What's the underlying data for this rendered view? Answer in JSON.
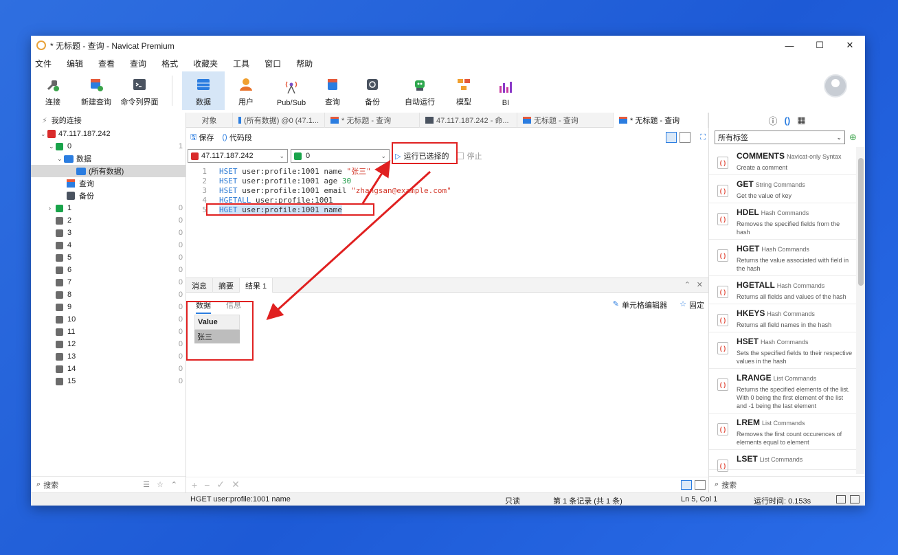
{
  "window": {
    "title": "* 无标题 - 查询 - Navicat Premium"
  },
  "menu": [
    "文件",
    "编辑",
    "查看",
    "查询",
    "格式",
    "收藏夹",
    "工具",
    "窗口",
    "帮助"
  ],
  "toolbar": {
    "connect": "连接",
    "new_query": "新建查询",
    "cmd": "命令列界面",
    "data": "数据",
    "user": "用户",
    "pubsub": "Pub/Sub",
    "query": "查询",
    "backup": "备份",
    "auto_run": "自动运行",
    "model": "模型",
    "bi": "BI"
  },
  "left": {
    "header": "我的连接",
    "connection": "47.117.187.242",
    "db0": "0",
    "db0_count": "1",
    "data_node": "数据",
    "all_data": "(所有数据)",
    "query_node": "查询",
    "backup_node": "备份",
    "dbs": [
      {
        "name": "1",
        "count": "0"
      },
      {
        "name": "2",
        "count": "0"
      },
      {
        "name": "3",
        "count": "0"
      },
      {
        "name": "4",
        "count": "0"
      },
      {
        "name": "5",
        "count": "0"
      },
      {
        "name": "6",
        "count": "0"
      },
      {
        "name": "7",
        "count": "0"
      },
      {
        "name": "8",
        "count": "0"
      },
      {
        "name": "9",
        "count": "0"
      },
      {
        "name": "10",
        "count": "0"
      },
      {
        "name": "11",
        "count": "0"
      },
      {
        "name": "12",
        "count": "0"
      },
      {
        "name": "13",
        "count": "0"
      },
      {
        "name": "14",
        "count": "0"
      },
      {
        "name": "15",
        "count": "0"
      }
    ],
    "search": "搜索"
  },
  "tabs": [
    "对象",
    "(所有数据) @0 (47.1...",
    "* 无标题 - 查询",
    "47.117.187.242 - 命...",
    "无标题 - 查询",
    "* 无标题 - 查询"
  ],
  "query_toolbar": {
    "save": "保存",
    "snippet": "代码段"
  },
  "connbar": {
    "conn": "47.117.187.242",
    "db": "0",
    "run_selected": "运行已选择的",
    "stop": "停止"
  },
  "editor": {
    "l1_cmd": "HSET",
    "l1_key": " user:profile:1001 name ",
    "l1_val": "\"张三\"",
    "l2_cmd": "HSET",
    "l2_key": " user:profile:1001 age ",
    "l2_val": "30",
    "l3_cmd": "HSET",
    "l3_key": " user:profile:1001 email ",
    "l3_val": "\"zhangsan@example.com\"",
    "l4_cmd": "HGETALL",
    "l4_key": " user:profile:1001",
    "l5_cmd": "HGET",
    "l5_key": " user:profile:1001 name"
  },
  "results": {
    "tabs": [
      "消息",
      "摘要",
      "结果 1"
    ],
    "subtab_data": "数据",
    "subtab_info": "信息",
    "cell_editor": "单元格编辑器",
    "pin": "固定",
    "col_header": "Value",
    "cell_value": "张三"
  },
  "right": {
    "tag_select": "所有标签",
    "snippets": [
      {
        "name": "COMMENTS",
        "cat": "Navicat-only Syntax",
        "desc": "Create a comment"
      },
      {
        "name": "GET",
        "cat": "String Commands",
        "desc": "Get the value of key"
      },
      {
        "name": "HDEL",
        "cat": "Hash Commands",
        "desc": "Removes the specified fields from the hash"
      },
      {
        "name": "HGET",
        "cat": "Hash Commands",
        "desc": "Returns the value associated with field in the hash"
      },
      {
        "name": "HGETALL",
        "cat": "Hash Commands",
        "desc": "Returns all fields and values of the hash"
      },
      {
        "name": "HKEYS",
        "cat": "Hash Commands",
        "desc": "Returns all field names in the hash"
      },
      {
        "name": "HSET",
        "cat": "Hash Commands",
        "desc": "Sets the specified fields to their respective values in the hash"
      },
      {
        "name": "LRANGE",
        "cat": "List Commands",
        "desc": "Returns the specified elements of the list. With 0 being the first element of the list and -1 being the last element"
      },
      {
        "name": "LREM",
        "cat": "List Commands",
        "desc": "Removes the first count occurences of elements equal to element"
      },
      {
        "name": "LSET",
        "cat": "List Commands",
        "desc": ""
      }
    ],
    "search": "搜索"
  },
  "status": {
    "sql": "HGET user:profile:1001 name",
    "readonly": "只读",
    "records": "第 1 条记录 (共 1 条)",
    "cursor": "Ln 5, Col 1",
    "runtime": "运行时间: 0.153s"
  }
}
